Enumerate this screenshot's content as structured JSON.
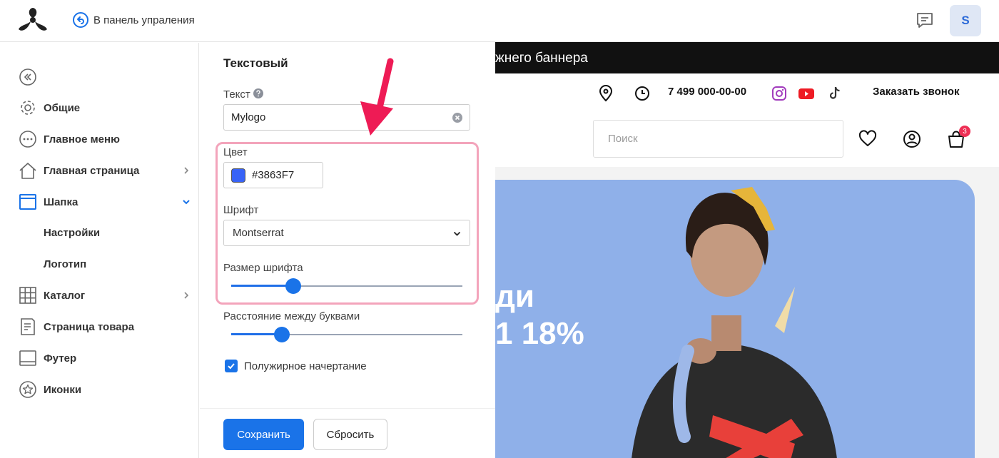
{
  "topbar": {
    "back_label": "В панель упраления",
    "avatar_letter": "S"
  },
  "sidebar": {
    "items": [
      {
        "label": "Общие",
        "icon": "gear-icon"
      },
      {
        "label": "Главное меню",
        "icon": "dots-circle-icon"
      },
      {
        "label": "Главная страница",
        "icon": "home-icon"
      },
      {
        "label": "Шапка",
        "icon": "header-window-icon"
      },
      {
        "label": "Каталог",
        "icon": "grid-icon"
      },
      {
        "label": "Страница товара",
        "icon": "document-icon"
      },
      {
        "label": "Футер",
        "icon": "footer-window-icon"
      },
      {
        "label": "Иконки",
        "icon": "star-circle-icon"
      }
    ],
    "sub_items": [
      "Настройки",
      "Логотип"
    ]
  },
  "panel": {
    "title": "Текстовый",
    "text_label": "Текст",
    "text_value": "Mylogo",
    "color_label": "Цвет",
    "color_value": "#3863F7",
    "font_label": "Шрифт",
    "font_value": "Montserrat",
    "font_size_label": "Размер шрифта",
    "font_size_level": 0.27,
    "letter_spacing_label": "Расстояние между буквами",
    "letter_spacing_level": 0.22,
    "bold_label": "Полужирное начертание",
    "bold_checked": true,
    "save_label": "Сохранить",
    "reset_label": "Сбросить"
  },
  "preview": {
    "promo_text": "жнего баннера",
    "phone": "7 499 000-00-00",
    "callback_label": "Заказать звонок",
    "search_placeholder": "Поиск",
    "cart_count": "3",
    "banner_text_line1": "ди",
    "banner_text_line2": "1 18%"
  },
  "colors": {
    "accent": "#1a73e8",
    "swatch": "#3863F7",
    "highlight_border": "#f3a4bb",
    "arrow": "#ee1b55",
    "banner_bg": "#8fb0e9"
  }
}
